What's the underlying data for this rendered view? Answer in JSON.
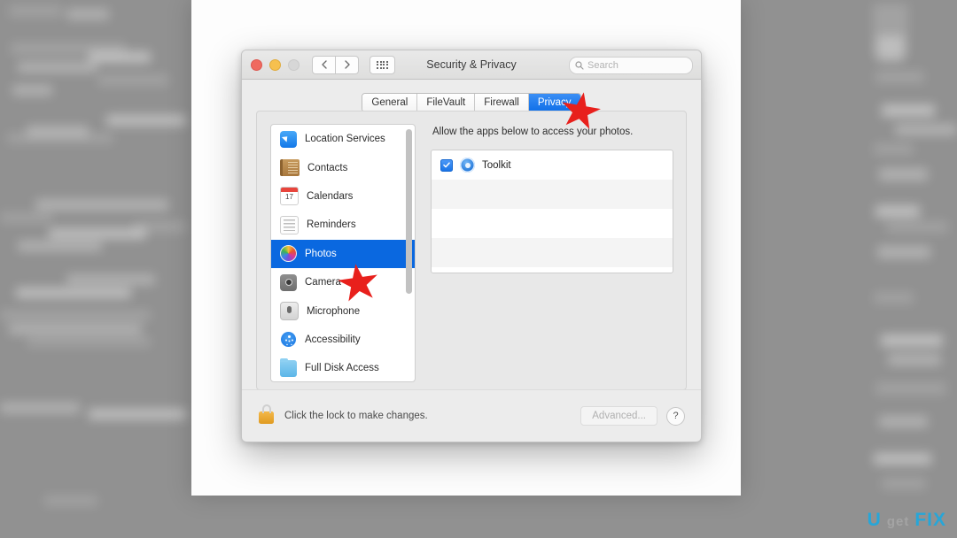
{
  "window": {
    "title": "Security & Privacy",
    "traffic_lights": [
      "close",
      "minimize",
      "zoom"
    ],
    "nav": {
      "back": "‹",
      "forward": "›",
      "grid": "grid-view"
    },
    "search": {
      "placeholder": "Search",
      "value": ""
    }
  },
  "tabs": [
    {
      "label": "General",
      "active": false
    },
    {
      "label": "FileVault",
      "active": false
    },
    {
      "label": "Firewall",
      "active": false
    },
    {
      "label": "Privacy",
      "active": true
    }
  ],
  "sidebar": {
    "items": [
      {
        "label": "Location Services",
        "icon": "location-services-icon",
        "selected": false
      },
      {
        "label": "Contacts",
        "icon": "contacts-icon",
        "selected": false
      },
      {
        "label": "Calendars",
        "icon": "calendars-icon",
        "selected": false,
        "day": "17"
      },
      {
        "label": "Reminders",
        "icon": "reminders-icon",
        "selected": false
      },
      {
        "label": "Photos",
        "icon": "photos-icon",
        "selected": true
      },
      {
        "label": "Camera",
        "icon": "camera-icon",
        "selected": false
      },
      {
        "label": "Microphone",
        "icon": "microphone-icon",
        "selected": false
      },
      {
        "label": "Accessibility",
        "icon": "accessibility-icon",
        "selected": false
      },
      {
        "label": "Full Disk Access",
        "icon": "full-disk-access-icon",
        "selected": false
      }
    ]
  },
  "pane": {
    "description": "Allow the apps below to access your photos.",
    "apps": [
      {
        "name": "Toolkit",
        "checked": true,
        "icon": "toolkit-app-icon"
      }
    ]
  },
  "bottom": {
    "lock_text": "Click the lock to make changes.",
    "lock_state": "locked",
    "advanced_label": "Advanced...",
    "advanced_enabled": false,
    "help_label": "?"
  },
  "annotations": [
    {
      "name": "star-privacy-tab",
      "shape": "red-star"
    },
    {
      "name": "star-camera-row",
      "shape": "red-star"
    }
  ],
  "watermark": {
    "left": "U",
    "middle": "get",
    "right": "FIX"
  },
  "colors": {
    "accent_blue": "#0a68e0",
    "tab_blue": "#0f6fe8",
    "star_red": "#e8201c",
    "lock_gold": "#e09b21",
    "watermark_blue": "#27a6d8"
  }
}
